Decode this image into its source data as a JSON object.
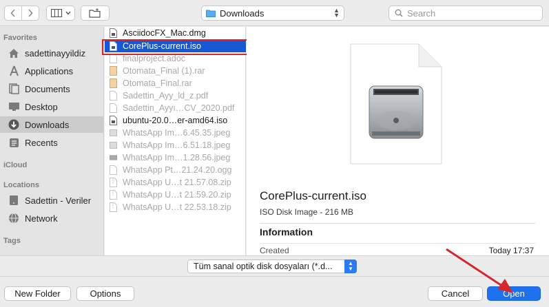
{
  "toolbar": {
    "location_label": "Downloads",
    "search_placeholder": "Search"
  },
  "sidebar": {
    "favorites_header": "Favorites",
    "favorites": [
      {
        "label": "sadettinayyildiz",
        "icon": "home-icon"
      },
      {
        "label": "Applications",
        "icon": "applications-icon"
      },
      {
        "label": "Documents",
        "icon": "documents-icon"
      },
      {
        "label": "Desktop",
        "icon": "desktop-icon"
      },
      {
        "label": "Downloads",
        "icon": "downloads-icon",
        "selected": true
      },
      {
        "label": "Recents",
        "icon": "recents-icon"
      }
    ],
    "icloud_header": "iCloud",
    "locations_header": "Locations",
    "locations": [
      {
        "label": "Sadettin - Veriler",
        "icon": "drive-icon"
      },
      {
        "label": "Network",
        "icon": "network-icon"
      }
    ],
    "tags_header": "Tags"
  },
  "files": [
    {
      "name": "AsciidocFX_Mac.dmg",
      "state": "enabled"
    },
    {
      "name": "CorePlus-current.iso",
      "state": "selected"
    },
    {
      "name": "finalproject.adoc",
      "state": "disabled"
    },
    {
      "name": "Otomata_Final (1).rar",
      "state": "disabled"
    },
    {
      "name": "Otomata_Final.rar",
      "state": "disabled"
    },
    {
      "name": "Sadettin_Ayy_ld_z.pdf",
      "state": "disabled"
    },
    {
      "name": "Sadettin_Ayyı…CV_2020.pdf",
      "state": "disabled"
    },
    {
      "name": "ubuntu-20.0…er-amd64.iso",
      "state": "enabled"
    },
    {
      "name": "WhatsApp Im…6.45.35.jpeg",
      "state": "disabled"
    },
    {
      "name": "WhatsApp Im…6.51.18.jpeg",
      "state": "disabled"
    },
    {
      "name": "WhatsApp Im…1.28.56.jpeg",
      "state": "disabled"
    },
    {
      "name": "WhatsApp Pt…21.24.20.ogg",
      "state": "disabled"
    },
    {
      "name": "WhatsApp U…t 21.57.08.zip",
      "state": "disabled"
    },
    {
      "name": "WhatsApp U…t 21.59.20.zip",
      "state": "disabled"
    },
    {
      "name": "WhatsApp U…t 22.53.18.zip",
      "state": "disabled"
    }
  ],
  "preview": {
    "filename": "CorePlus-current.iso",
    "kind": "ISO Disk Image - 216 MB",
    "info_header": "Information",
    "created_label": "Created",
    "created_value": "Today 17:37"
  },
  "filter": {
    "selected": "Tüm sanal optik disk dosyaları (*.d..."
  },
  "buttons": {
    "new_folder": "New Folder",
    "options": "Options",
    "cancel": "Cancel",
    "open": "Open"
  },
  "colors": {
    "accent": "#1e72f0",
    "selection": "#1758d4",
    "annotation": "#d3272c"
  }
}
